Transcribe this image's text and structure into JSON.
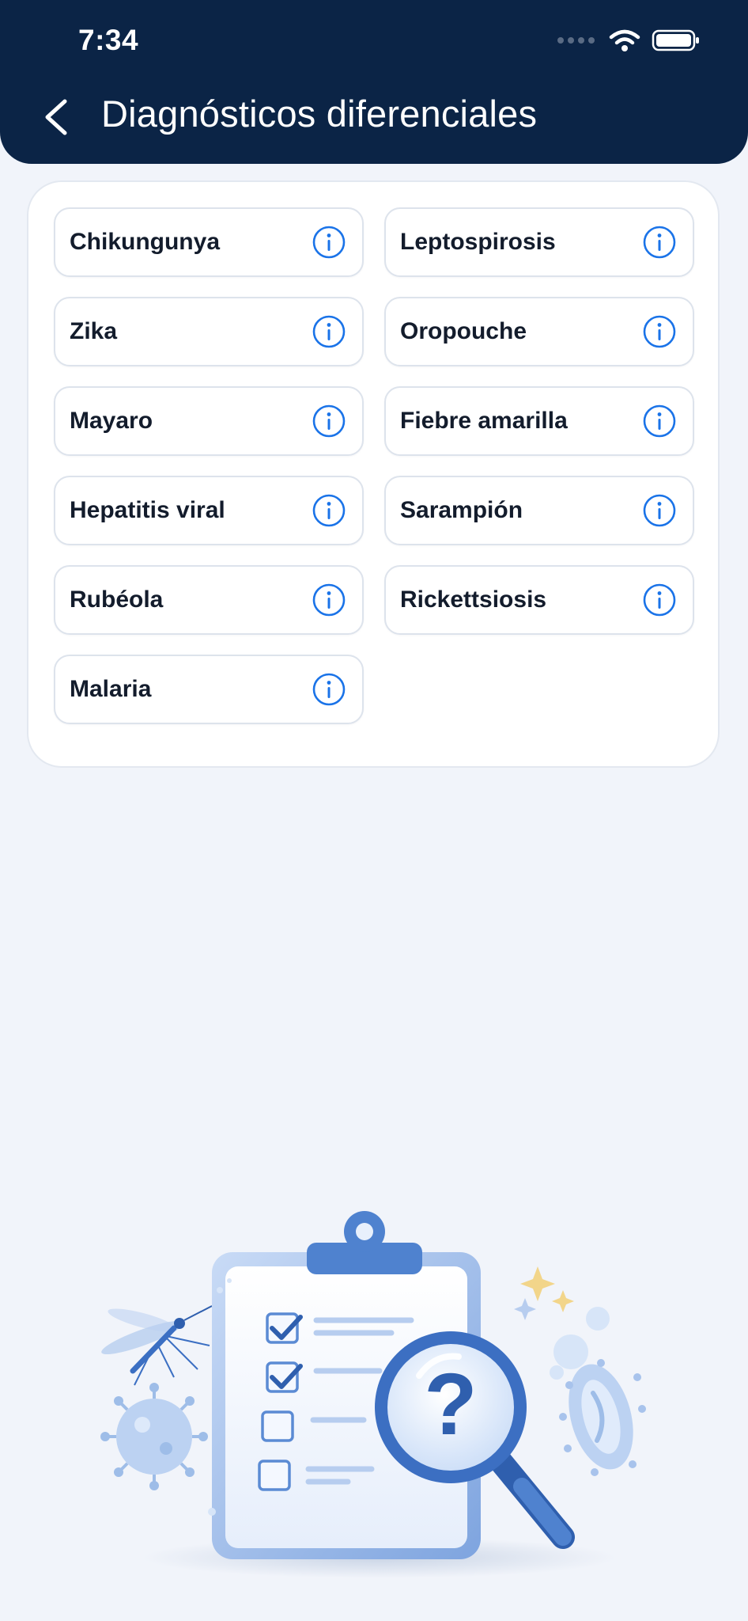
{
  "status_bar": {
    "time": "7:34"
  },
  "header": {
    "title": "Diagnósticos diferenciales",
    "back_icon": "chevron-left-icon"
  },
  "diagnoses": [
    {
      "label": "Chikungunya"
    },
    {
      "label": "Leptospirosis"
    },
    {
      "label": "Zika"
    },
    {
      "label": "Oropouche"
    },
    {
      "label": "Mayaro"
    },
    {
      "label": "Fiebre amarilla"
    },
    {
      "label": "Hepatitis viral"
    },
    {
      "label": "Sarampión"
    },
    {
      "label": "Rubéola"
    },
    {
      "label": "Rickettsiosis"
    },
    {
      "label": "Malaria"
    }
  ],
  "colors": {
    "header_bg": "#0b2446",
    "accent": "#1a73e8",
    "page_bg": "#f1f4fa"
  },
  "illustration": {
    "icon": "clipboard-magnifier-illustration"
  }
}
